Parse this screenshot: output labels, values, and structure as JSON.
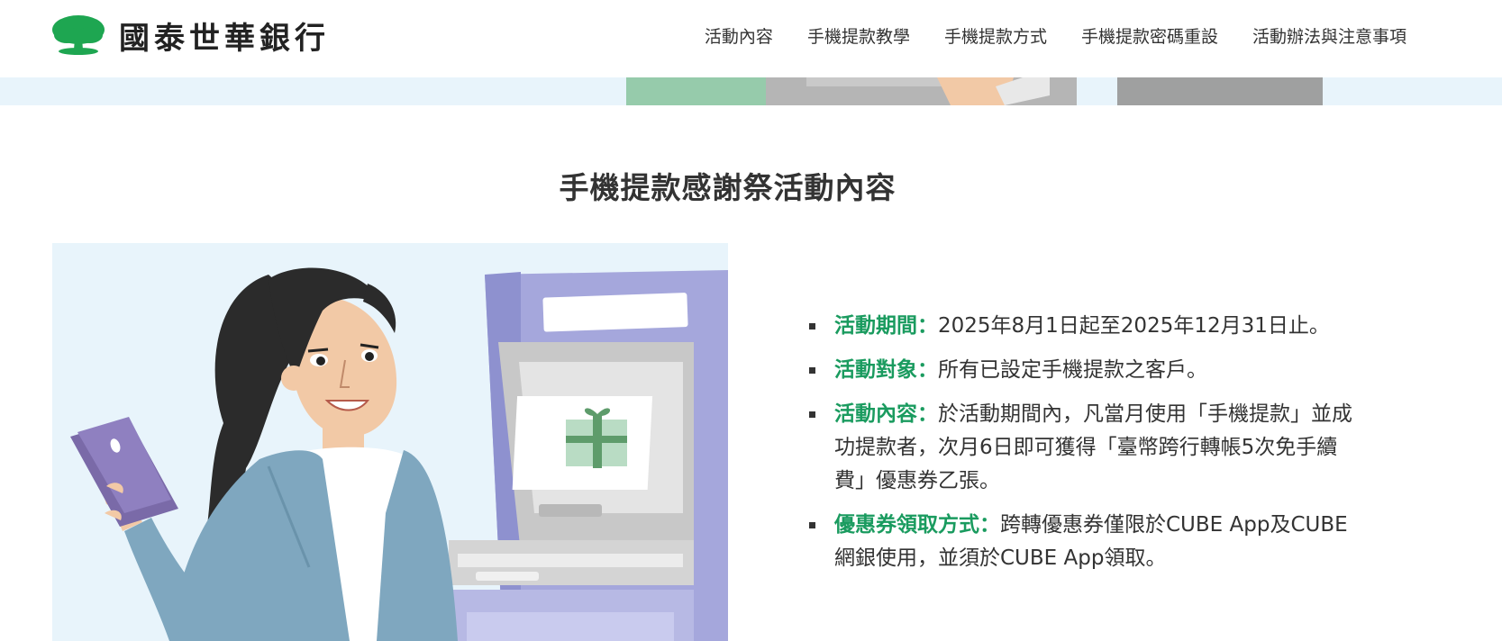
{
  "header": {
    "brand": "國泰世華銀行",
    "logo_icon": "tree-logo-icon",
    "brand_color": "#1ea651",
    "nav": [
      {
        "label": "活動內容"
      },
      {
        "label": "手機提款教學"
      },
      {
        "label": "手機提款方式"
      },
      {
        "label": "手機提款密碼重設"
      },
      {
        "label": "活動辦法與注意事項"
      }
    ]
  },
  "section": {
    "title": "手機提款感謝祭活動內容"
  },
  "illustration": {
    "icons": [
      "woman-with-phone-illustration",
      "atm-illustration",
      "gift-icon"
    ]
  },
  "info": [
    {
      "label": "活動期間：",
      "text": "2025年8月1日起至2025年12月31日止。"
    },
    {
      "label": "活動對象：",
      "text": "所有已設定手機提款之客戶。"
    },
    {
      "label": "活動內容：",
      "text": "於活動期間內，凡當月使用「手機提款」並成功提款者，次月6日即可獲得「臺幣跨行轉帳5次免手續費」優惠券乙張。"
    },
    {
      "label": "優惠券領取方式：",
      "text": "跨轉優惠券僅限於CUBE App及CUBE網銀使用，並須於CUBE App領取。"
    }
  ],
  "colors": {
    "accent_green": "#1a9b5f",
    "light_blue_bg": "#e8f4fb",
    "atm_purple": "#a5a7dc"
  }
}
